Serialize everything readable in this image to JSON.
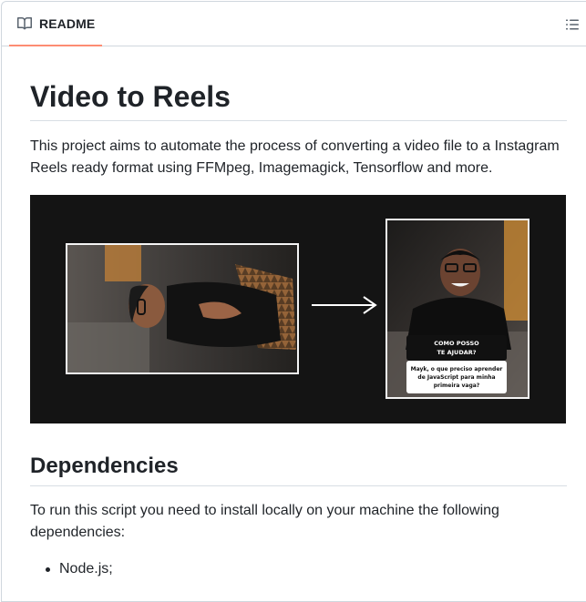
{
  "header": {
    "tab_label": "README",
    "tab_icon": "book-icon",
    "toc_icon": "list-unordered-icon"
  },
  "article": {
    "title": "Video to Reels",
    "intro": "This project aims to automate the process of converting a video file to a Instagram Reels ready format using FFMpeg, Imagemagick, Tensorflow and more.",
    "image": {
      "question_line1": "COMO POSSO",
      "question_line2": "TE AJUDAR?",
      "answer_line1": "Mayk, o que preciso aprender",
      "answer_line2": "de JavaScript para minha",
      "answer_line3": "primeira vaga?"
    },
    "dependencies_heading": "Dependencies",
    "dependencies_text": "To run this script you need to install locally on your machine the following dependencies:",
    "dependencies": [
      "Node.js;"
    ]
  },
  "colors": {
    "tab_underline": "#fd8c73",
    "border": "#d0d7de",
    "text": "#1f2328",
    "image_bg": "#141414"
  }
}
